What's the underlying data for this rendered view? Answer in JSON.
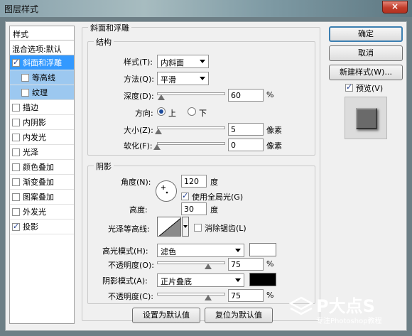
{
  "window": {
    "title": "图层样式",
    "close_glyph": "×"
  },
  "left_list": {
    "header": "样式",
    "blend_options": "混合选项:默认",
    "items": [
      {
        "label": "斜面和浮雕",
        "checked": true,
        "state": "selected",
        "sub": false
      },
      {
        "label": "等高线",
        "checked": false,
        "state": "subselected",
        "sub": true
      },
      {
        "label": "纹理",
        "checked": false,
        "state": "subselected",
        "sub": true
      },
      {
        "label": "描边",
        "checked": false,
        "state": "",
        "sub": false
      },
      {
        "label": "内阴影",
        "checked": false,
        "state": "",
        "sub": false
      },
      {
        "label": "内发光",
        "checked": false,
        "state": "",
        "sub": false
      },
      {
        "label": "光泽",
        "checked": false,
        "state": "",
        "sub": false
      },
      {
        "label": "颜色叠加",
        "checked": false,
        "state": "",
        "sub": false
      },
      {
        "label": "渐变叠加",
        "checked": false,
        "state": "",
        "sub": false
      },
      {
        "label": "图案叠加",
        "checked": false,
        "state": "",
        "sub": false
      },
      {
        "label": "外发光",
        "checked": false,
        "state": "",
        "sub": false
      },
      {
        "label": "投影",
        "checked": true,
        "state": "",
        "sub": false
      }
    ]
  },
  "bevel": {
    "group_title": "斜面和浮雕",
    "structure": {
      "title": "结构",
      "style_label": "样式(T):",
      "style_value": "内斜面",
      "method_label": "方法(Q):",
      "method_value": "平滑",
      "depth_label": "深度(D):",
      "depth_value": "60",
      "depth_unit": "%",
      "depth_slider_fraction": 0.06,
      "direction_label": "方向:",
      "direction_up": "上",
      "direction_down": "下",
      "direction_selected": "上",
      "size_label": "大小(Z):",
      "size_value": "5",
      "size_unit": "像素",
      "size_slider_fraction": 0.02,
      "soften_label": "软化(F):",
      "soften_value": "0",
      "soften_unit": "像素",
      "soften_slider_fraction": 0.0
    },
    "shading": {
      "title": "阴影",
      "angle_label": "角度(N):",
      "angle_value": "120",
      "angle_unit": "度",
      "global_light_label": "使用全局光(G)",
      "global_light_checked": true,
      "altitude_label": "高度:",
      "altitude_value": "30",
      "altitude_unit": "度",
      "gloss_contour_label": "光泽等高线:",
      "antialias_label": "消除锯齿(L)",
      "antialias_checked": false,
      "highlight_mode_label": "高光模式(H):",
      "highlight_mode_value": "滤色",
      "highlight_color": "#ffffff",
      "highlight_opacity_label": "不透明度(O):",
      "highlight_opacity_value": "75",
      "highlight_opacity_unit": "%",
      "highlight_opacity_fraction": 0.75,
      "shadow_mode_label": "阴影模式(A):",
      "shadow_mode_value": "正片叠底",
      "shadow_color": "#000000",
      "shadow_opacity_label": "不透明度(C):",
      "shadow_opacity_value": "75",
      "shadow_opacity_unit": "%",
      "shadow_opacity_fraction": 0.75
    },
    "make_default": "设置为默认值",
    "reset_default": "复位为默认值"
  },
  "right": {
    "ok": "确定",
    "cancel": "取消",
    "new_style": "新建样式(W)...",
    "preview_label": "预览(V)",
    "preview_checked": true
  },
  "watermark": {
    "brand": "P大点S",
    "tagline": "专注Photoshop教程"
  }
}
